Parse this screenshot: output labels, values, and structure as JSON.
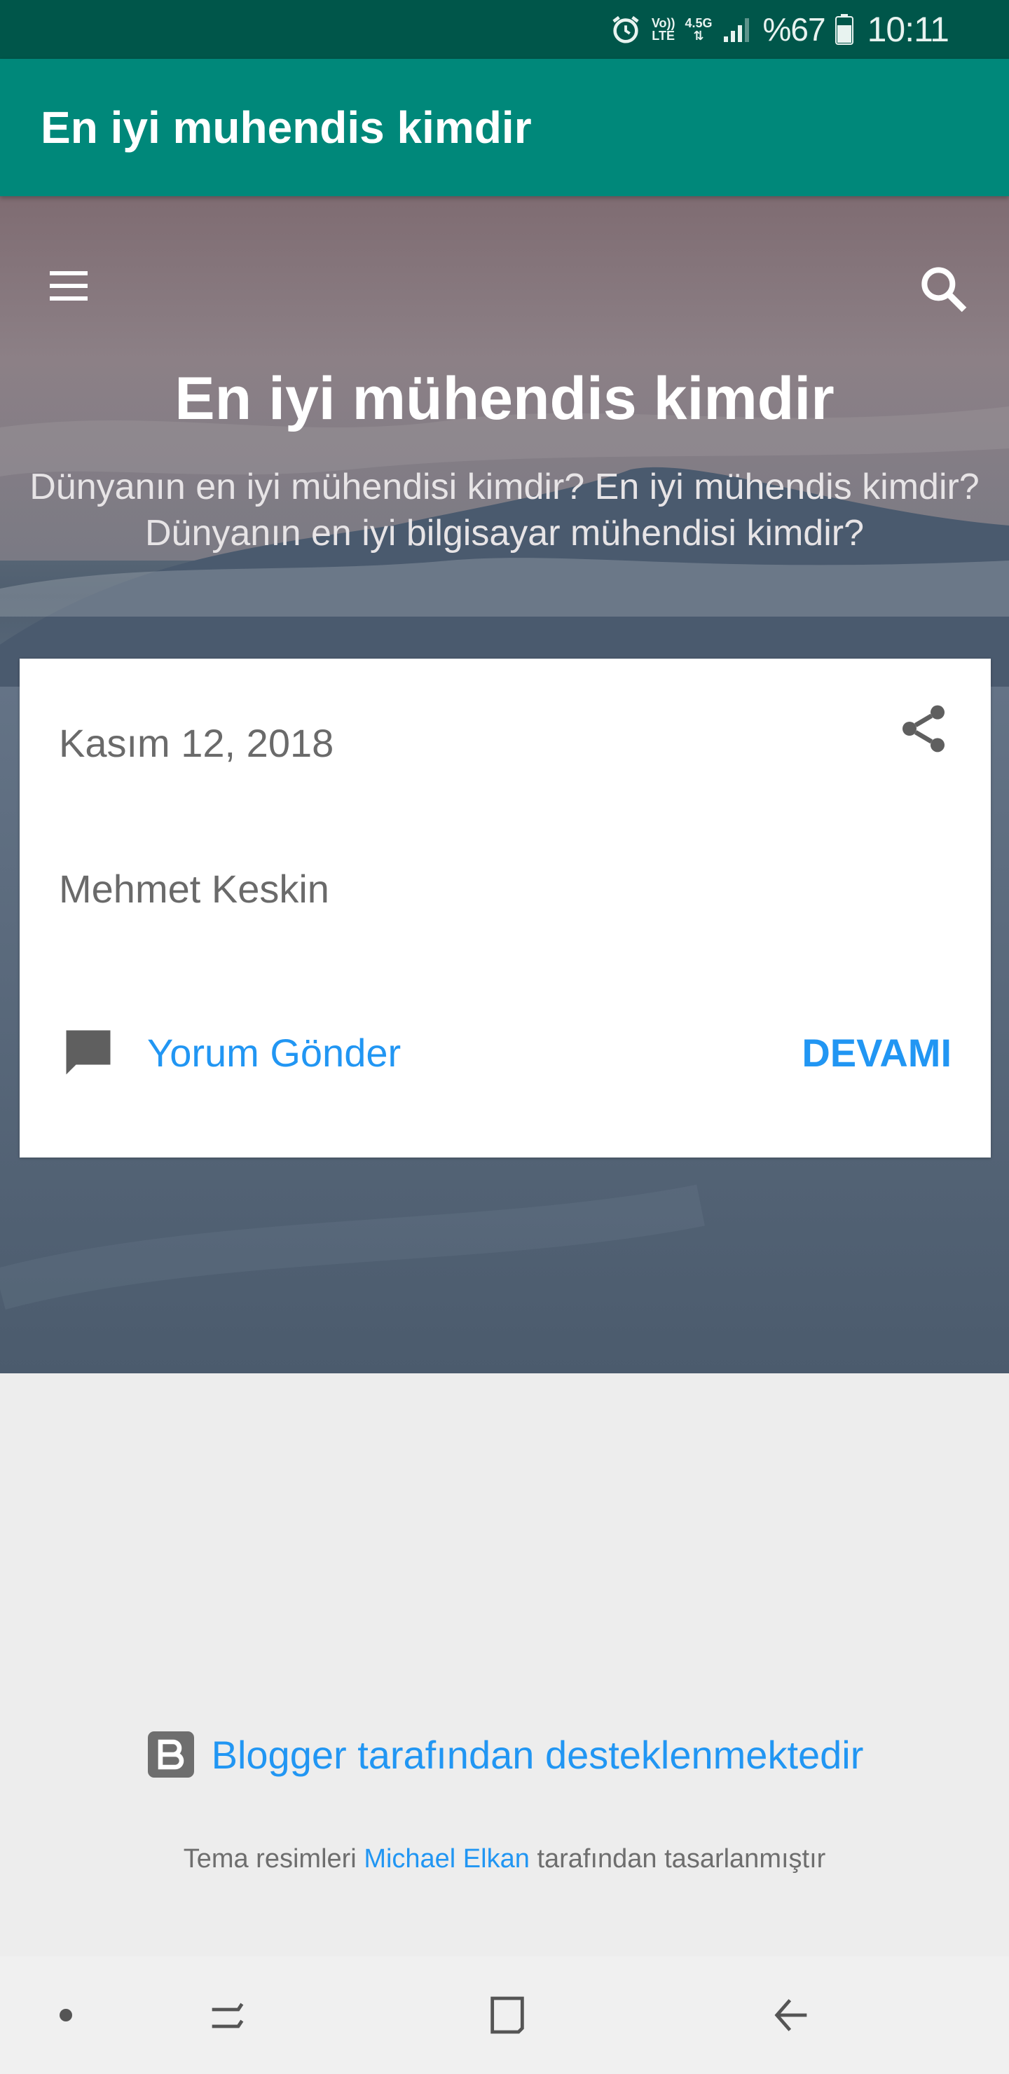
{
  "status_bar": {
    "volte_top": "Vo))",
    "volte_bottom": "LTE",
    "network": "4.5G",
    "battery": "%67",
    "time": "10:11",
    "icons": [
      "alarm-icon",
      "signal-icon",
      "battery-icon"
    ]
  },
  "app_bar": {
    "title": "En iyi muhendis kimdir"
  },
  "hero": {
    "title": "En iyi mühendis kimdir",
    "description": "Dünyanın en iyi mühendisi kimdir? En iyi mühendis kimdir? Dünyanın en iyi bilgisayar mühendisi kimdir?",
    "icons": [
      "menu-icon",
      "search-icon"
    ]
  },
  "post": {
    "date": "Kasım 12, 2018",
    "author": "Mehmet Keskin",
    "comment_label": "Yorum Gönder",
    "more_label": "DEVAMI",
    "icons": [
      "share-icon",
      "comment-icon"
    ]
  },
  "footer": {
    "powered_by": "Blogger tarafından desteklenmektedir",
    "credits_prefix": "Tema resimleri",
    "credits_author": "Michael Elkan",
    "credits_suffix": "tarafından tasarlanmıştır"
  },
  "nav_bar": {
    "icons": [
      "dot-icon",
      "recent-apps-icon",
      "home-icon",
      "back-icon"
    ]
  },
  "colors": {
    "status_bar": "#00564a",
    "app_bar": "#00887a",
    "link": "#2196f3",
    "footer_bg": "#ededed"
  }
}
